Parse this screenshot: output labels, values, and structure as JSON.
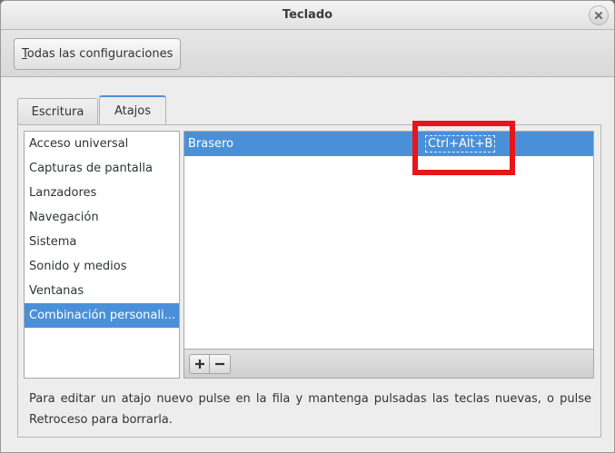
{
  "window": {
    "title": "Teclado"
  },
  "toolbar": {
    "all_settings_mnemonic": "T",
    "all_settings_rest": "odas las configuraciones"
  },
  "tabs": [
    {
      "label": "Escritura",
      "active": false
    },
    {
      "label": "Atajos",
      "active": true
    }
  ],
  "sections": [
    {
      "label": "Acceso universal",
      "selected": false
    },
    {
      "label": "Capturas de pantalla",
      "selected": false
    },
    {
      "label": "Lanzadores",
      "selected": false
    },
    {
      "label": "Navegación",
      "selected": false
    },
    {
      "label": "Sistema",
      "selected": false
    },
    {
      "label": "Sonido y medios",
      "selected": false
    },
    {
      "label": "Ventanas",
      "selected": false
    },
    {
      "label": "Combinación personali...",
      "selected": true
    }
  ],
  "shortcuts": [
    {
      "name": "Brasero",
      "accel": "Ctrl+Alt+B",
      "selected": true
    }
  ],
  "table_toolbar": {
    "add_label": "+",
    "remove_label": "−"
  },
  "help_text": "Para editar un atajo nuevo pulse en la fila y mantenga pulsadas las teclas nuevas, o pulse Retroceso para borrarla.",
  "colors": {
    "selection": "#4a90d9",
    "highlight_annotation": "#e8151b"
  },
  "icons": {
    "close": "close-icon"
  }
}
